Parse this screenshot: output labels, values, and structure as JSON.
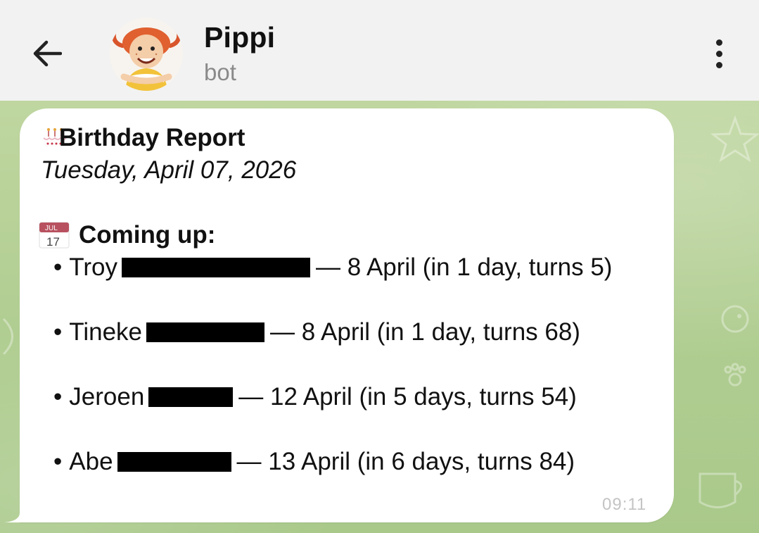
{
  "header": {
    "title": "Pippi",
    "subtitle": "bot",
    "back_icon": "arrow-left-icon",
    "menu_icon": "more-vertical-icon"
  },
  "message": {
    "title_icon": "birthday-cake-icon",
    "title": "Birthday Report",
    "date": "Tuesday, April 07, 2026",
    "section_icon": "calendar-icon",
    "calendar_month": "JUL",
    "calendar_day": "17",
    "section_title": "Coming up:",
    "entries": [
      {
        "bullet": "•",
        "first_name": "Troy",
        "details": "— 8 April (in 1 day, turns 5)"
      },
      {
        "bullet": "•",
        "first_name": "Tineke",
        "details": "— 8 April (in 1 day, turns 68)"
      },
      {
        "bullet": "•",
        "first_name": "Jeroen",
        "details": "— 12 April (in 5 days, turns 54)"
      },
      {
        "bullet": "•",
        "first_name": "Abe",
        "details": "— 13 April (in 6 days, turns 84)"
      }
    ],
    "time": "09:11"
  },
  "colors": {
    "header_bg": "#f2f2f2",
    "wallpaper": "#b5cf97",
    "bubble_bg": "#ffffff",
    "time_text": "#c4c4c4"
  }
}
